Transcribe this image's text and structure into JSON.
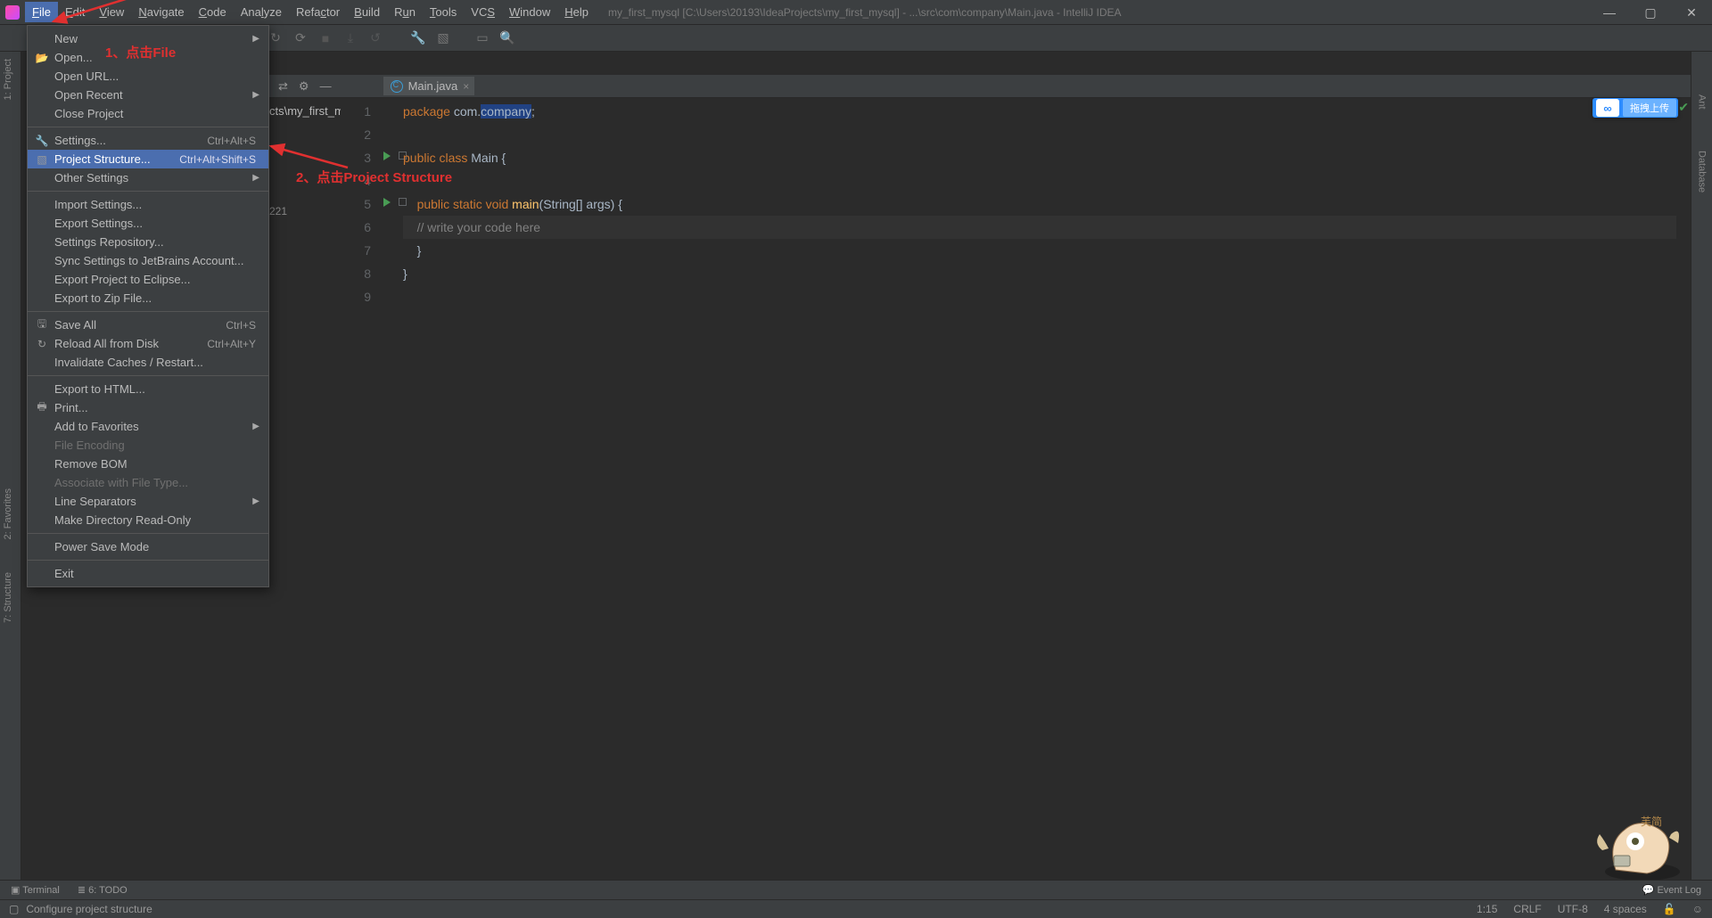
{
  "menubar": [
    "File",
    "Edit",
    "View",
    "Navigate",
    "Code",
    "Analyze",
    "Refactor",
    "Build",
    "Run",
    "Tools",
    "VCS",
    "Window",
    "Help"
  ],
  "menubar_underline_idx": [
    0,
    0,
    0,
    0,
    0,
    3,
    4,
    0,
    1,
    0,
    2,
    0,
    0
  ],
  "active_menu_index": 0,
  "title": "my_first_mysql [C:\\Users\\20193\\IdeaProjects\\my_first_mysql] - ...\\src\\com\\company\\Main.java - IntelliJ IDEA",
  "file_menu": [
    {
      "t": "item",
      "label": "New",
      "arrow": true
    },
    {
      "t": "item",
      "label": "Open...",
      "icon": "📂"
    },
    {
      "t": "item",
      "label": "Open URL..."
    },
    {
      "t": "item",
      "label": "Open Recent",
      "arrow": true
    },
    {
      "t": "item",
      "label": "Close Project"
    },
    {
      "t": "sep"
    },
    {
      "t": "item",
      "label": "Settings...",
      "icon": "🔧",
      "shortcut": "Ctrl+Alt+S"
    },
    {
      "t": "item",
      "label": "Project Structure...",
      "icon": "▧",
      "shortcut": "Ctrl+Alt+Shift+S",
      "selected": true
    },
    {
      "t": "item",
      "label": "Other Settings",
      "arrow": true
    },
    {
      "t": "sep"
    },
    {
      "t": "item",
      "label": "Import Settings..."
    },
    {
      "t": "item",
      "label": "Export Settings..."
    },
    {
      "t": "item",
      "label": "Settings Repository..."
    },
    {
      "t": "item",
      "label": "Sync Settings to JetBrains Account..."
    },
    {
      "t": "item",
      "label": "Export Project to Eclipse..."
    },
    {
      "t": "item",
      "label": "Export to Zip File..."
    },
    {
      "t": "sep"
    },
    {
      "t": "item",
      "label": "Save All",
      "icon": "🖫",
      "shortcut": "Ctrl+S"
    },
    {
      "t": "item",
      "label": "Reload All from Disk",
      "icon": "↻",
      "shortcut": "Ctrl+Alt+Y"
    },
    {
      "t": "item",
      "label": "Invalidate Caches / Restart..."
    },
    {
      "t": "sep"
    },
    {
      "t": "item",
      "label": "Export to HTML..."
    },
    {
      "t": "item",
      "label": "Print...",
      "icon": "🖶"
    },
    {
      "t": "item",
      "label": "Add to Favorites",
      "arrow": true
    },
    {
      "t": "item",
      "label": "File Encoding",
      "disabled": true
    },
    {
      "t": "item",
      "label": "Remove BOM"
    },
    {
      "t": "item",
      "label": "Associate with File Type...",
      "disabled": true
    },
    {
      "t": "item",
      "label": "Line Separators",
      "arrow": true
    },
    {
      "t": "item",
      "label": "Make Directory Read-Only"
    },
    {
      "t": "sep"
    },
    {
      "t": "item",
      "label": "Power Save Mode"
    },
    {
      "t": "sep"
    },
    {
      "t": "item",
      "label": "Exit"
    }
  ],
  "tab": {
    "name": "Main.java"
  },
  "left_tools": [
    "1: Project",
    "2: Favorites",
    "7: Structure"
  ],
  "right_tools": [
    "Ant",
    "Database"
  ],
  "behind_text1": "cts\\my_first_my",
  "behind_text2": "221",
  "code_lines": [
    {
      "n": 1,
      "html": "<span class='kw'>package</span> <span class='ident'>com.<span class='hi'>company</span>;</span>"
    },
    {
      "n": 2,
      "html": ""
    },
    {
      "n": 3,
      "html": "<span class='kw'>public class</span> <span class='ident'>Main {</span>",
      "run": true,
      "fold": true
    },
    {
      "n": 4,
      "html": ""
    },
    {
      "n": 5,
      "html": "    <span class='kw'>public static void</span> <span class='fn'>main</span><span class='ident'>(String[] args) {</span>",
      "run": true,
      "fold": true
    },
    {
      "n": 6,
      "html": "    <span class='cmt'>// write your code here</span>",
      "current": true
    },
    {
      "n": 7,
      "html": "    <span class='ident'>}</span>"
    },
    {
      "n": 8,
      "html": "<span class='ident'>}</span>"
    },
    {
      "n": 9,
      "html": ""
    }
  ],
  "bottom_tools": {
    "terminal": "Terminal",
    "todo": "6: TODO",
    "eventlog": "Event Log"
  },
  "status": {
    "msg": "Configure project structure",
    "pos": "1:15",
    "sep": "CRLF",
    "enc": "UTF-8",
    "indent": "4 spaces"
  },
  "cloud": {
    "label": "拖拽上传"
  },
  "anno1": "1、点击File",
  "anno2": "2、点击Project Structure"
}
